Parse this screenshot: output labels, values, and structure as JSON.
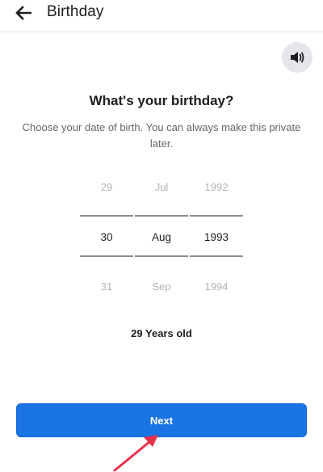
{
  "header": {
    "back_icon": "back-arrow-icon",
    "title": "Birthday"
  },
  "audio": {
    "icon": "speaker-icon"
  },
  "main": {
    "heading": "What's your birthday?",
    "subtitle": "Choose your date of birth. You can always make this private later."
  },
  "picker": {
    "day": {
      "prev": "29",
      "selected": "30",
      "next": "31"
    },
    "month": {
      "prev": "Jul",
      "selected": "Aug",
      "next": "Sep"
    },
    "year": {
      "prev": "1992",
      "selected": "1993",
      "next": "1994"
    }
  },
  "age_label": "29 Years old",
  "next_button": {
    "label": "Next"
  },
  "colors": {
    "primary": "#1b74e4",
    "annotation_arrow": "#e8334a"
  }
}
